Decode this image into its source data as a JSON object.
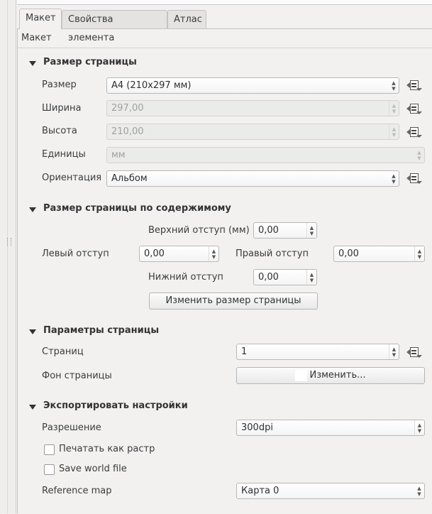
{
  "tabs": [
    "Макет",
    "Свойства элемента",
    "Атлас"
  ],
  "panel_title": "Макет",
  "page_size": {
    "header": "Размер страницы",
    "size_label": "Размер",
    "size_value": "A4 (210x297 мм)",
    "width_label": "Ширина",
    "width_value": "297,00",
    "height_label": "Высота",
    "height_value": "210,00",
    "units_label": "Единицы",
    "units_value": "мм",
    "orientation_label": "Ориентация",
    "orientation_value": "Альбом"
  },
  "resize": {
    "header": "Размер страницы по содержимому",
    "top_label": "Верхний отступ (мм)",
    "top_value": "0,00",
    "left_label": "Левый отступ",
    "left_value": "0,00",
    "right_label": "Правый отступ",
    "right_value": "0,00",
    "bottom_label": "Нижний отступ",
    "bottom_value": "0,00",
    "button": "Изменить размер страницы"
  },
  "page_params": {
    "header": "Параметры страницы",
    "pages_label": "Страниц",
    "pages_value": "1",
    "bg_label": "Фон страницы",
    "bg_button": "Изменить..."
  },
  "export": {
    "header": "Экспортировать настройки",
    "resolution_label": "Разрешение",
    "resolution_value": "300dpi",
    "print_raster": "Печатать как растр",
    "print_raster_checked": false,
    "world_file": "Save world file",
    "world_file_checked": false,
    "refmap_label": "Reference map",
    "refmap_value": "Карта 0"
  }
}
